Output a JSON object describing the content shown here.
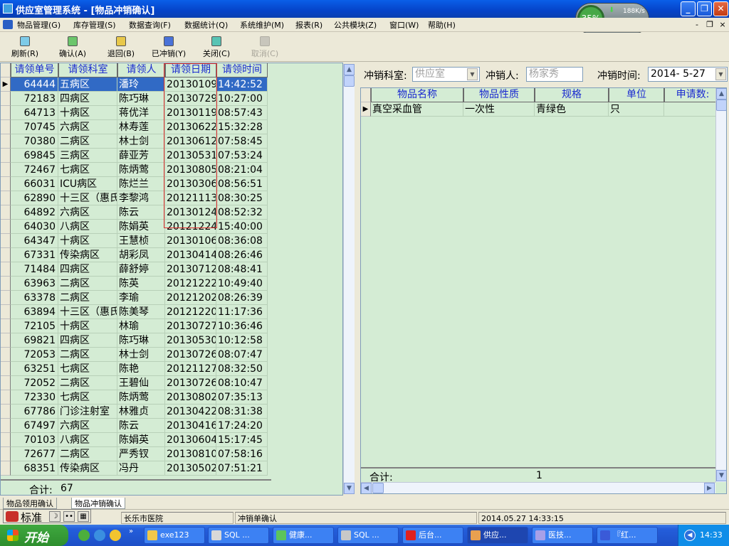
{
  "window": {
    "title": "供应室管理系统 - [物品冲销确认]",
    "controls": {
      "minimize": "_",
      "restore": "❐",
      "close": "✕"
    }
  },
  "netwidget": {
    "percent": "35%",
    "speed": "188K/s",
    "temp": "--℃"
  },
  "menu": [
    "物品管理(G)",
    "库存管理(S)",
    "数据查询(F)",
    "数据统计(Q)",
    "系统维护(M)",
    "报表(R)",
    "公共模块(Z)",
    "窗口(W)",
    "帮助(H)"
  ],
  "mdi": {
    "minimize": "-",
    "restore": "❐",
    "close": "×"
  },
  "toolbar": {
    "refresh": "刷新(R)",
    "confirm": "确认(A)",
    "return": "退回(B)",
    "written_off": "已冲销(Y)",
    "close": "关闭(C)",
    "cancel": "取消(C)"
  },
  "left_table": {
    "headers": [
      "请领单号",
      "请领科室",
      "请领人",
      "请领日期",
      "请领时间"
    ],
    "rows": [
      [
        "64444",
        "五病区",
        "潘玲",
        "20130109",
        "14:42:52"
      ],
      [
        "72183",
        "四病区",
        "陈巧琳",
        "20130729",
        "10:27:00"
      ],
      [
        "64713",
        "十病区",
        "蒋优洋",
        "20130119",
        "08:57:43"
      ],
      [
        "70745",
        "六病区",
        "林寿莲",
        "20130622",
        "15:32:28"
      ],
      [
        "70380",
        "二病区",
        "林士剑",
        "20130612",
        "07:58:45"
      ],
      [
        "69845",
        "三病区",
        "薛亚芳",
        "20130531",
        "07:53:24"
      ],
      [
        "72467",
        "七病区",
        "陈炳莺",
        "20130805",
        "08:21:04"
      ],
      [
        "66031",
        "ICU病区",
        "陈烂兰",
        "20130306",
        "08:56:51"
      ],
      [
        "62890",
        "十三区（惠氏",
        "李黎鸿",
        "20121113",
        "08:30:25"
      ],
      [
        "64892",
        "六病区",
        "陈云",
        "20130124",
        "08:52:32"
      ],
      [
        "64030",
        "八病区",
        "陈娟英",
        "20121224",
        "15:40:00"
      ],
      [
        "64347",
        "十病区",
        "王慧桢",
        "20130106",
        "08:36:08"
      ],
      [
        "67331",
        "传染病区",
        "胡彩凤",
        "20130414",
        "08:26:46"
      ],
      [
        "71484",
        "四病区",
        "薛舒婷",
        "20130712",
        "08:48:41"
      ],
      [
        "63963",
        "二病区",
        "陈英",
        "20121222",
        "10:49:40"
      ],
      [
        "63378",
        "二病区",
        "李瑜",
        "20121202",
        "08:26:39"
      ],
      [
        "63894",
        "十三区（惠氏",
        "陈美琴",
        "20121220",
        "11:17:36"
      ],
      [
        "72105",
        "十病区",
        "林瑜",
        "20130727",
        "10:36:46"
      ],
      [
        "69821",
        "四病区",
        "陈巧琳",
        "20130530",
        "10:12:58"
      ],
      [
        "72053",
        "二病区",
        "林士剑",
        "20130726",
        "08:07:47"
      ],
      [
        "63251",
        "七病区",
        "陈艳",
        "20121127",
        "08:32:50"
      ],
      [
        "72052",
        "二病区",
        "王碧仙",
        "20130726",
        "08:10:47"
      ],
      [
        "72330",
        "七病区",
        "陈炳莺",
        "20130802",
        "07:35:13"
      ],
      [
        "67786",
        "门诊注射室",
        "林雅贞",
        "20130422",
        "08:31:38"
      ],
      [
        "67497",
        "六病区",
        "陈云",
        "20130416",
        "17:24:20"
      ],
      [
        "70103",
        "八病区",
        "陈娟英",
        "20130604",
        "15:17:45"
      ],
      [
        "72677",
        "二病区",
        "严秀钗",
        "20130810",
        "07:58:16"
      ],
      [
        "68351",
        "传染病区",
        "冯丹",
        "20130502",
        "07:51:21"
      ]
    ],
    "total_label": "合计:",
    "total_value": "67"
  },
  "form": {
    "dept_label": "冲销科室:",
    "dept_value": "供应室",
    "person_label": "冲销人:",
    "person_value": "杨家秀",
    "time_label": "冲销时间:",
    "time_value": "2014- 5-27"
  },
  "right_table": {
    "headers": [
      "物品名称",
      "物品性质",
      "规格",
      "单位",
      "申请数:"
    ],
    "rows": [
      [
        "真空采血管",
        "一次性",
        "青绿色",
        "只",
        ""
      ]
    ],
    "total_label": "合计:",
    "total_value": "1"
  },
  "tabs": [
    "物品领用确认",
    "物品冲销确认"
  ],
  "ime": {
    "label": "标准"
  },
  "status": {
    "hospital": "长乐市医院",
    "form": "冲销单确认",
    "datetime": "2014.05.27 14:33:15"
  },
  "taskbar": {
    "start": "开始",
    "tasks": [
      "exe123",
      "SQL ...",
      "健康...",
      "SQL ...",
      "后台...",
      "供应...",
      "医技...",
      "『红..."
    ],
    "clock": "14:33"
  },
  "colors": {
    "grid_bg": "#d4ecd4",
    "header_text": "#1a2ad0",
    "selection": "#316ac5",
    "highlight_box": "#e03030",
    "xp_blue": "#245edb"
  }
}
